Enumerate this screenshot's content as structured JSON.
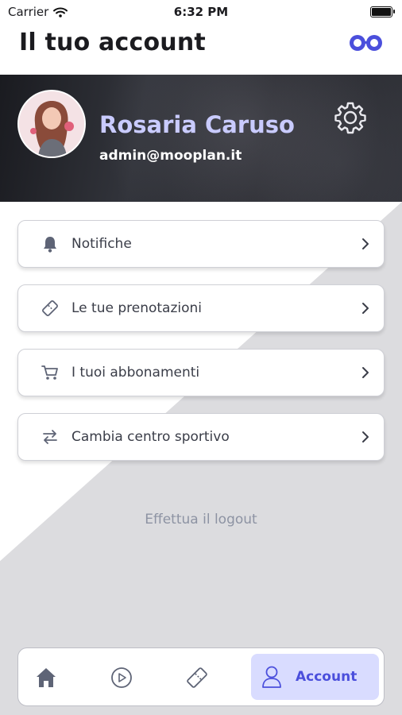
{
  "status_bar": {
    "carrier": "Carrier",
    "time": "6:32 PM"
  },
  "header": {
    "title": "Il tuo account",
    "logo_icon": "brand-logo-icon"
  },
  "profile": {
    "name": "Rosaria Caruso",
    "email": "admin@mooplan.it",
    "settings_icon": "gear-icon"
  },
  "menu": [
    {
      "label": "Notifiche",
      "icon": "bell-icon"
    },
    {
      "label": "Le tue prenotazioni",
      "icon": "ticket-icon"
    },
    {
      "label": "I tuoi abbonamenti",
      "icon": "cart-icon"
    },
    {
      "label": "Cambia centro sportivo",
      "icon": "swap-icon"
    }
  ],
  "logout_label": "Effettua il logout",
  "tabbar": {
    "items": [
      {
        "icon": "home-icon"
      },
      {
        "icon": "play-icon"
      },
      {
        "icon": "ticket-icon"
      },
      {
        "icon": "user-icon",
        "label": "Account",
        "active": true
      }
    ]
  },
  "colors": {
    "accent": "#4b4fdc",
    "accent_light": "#d9dcff",
    "name_color": "#c9cbff"
  }
}
